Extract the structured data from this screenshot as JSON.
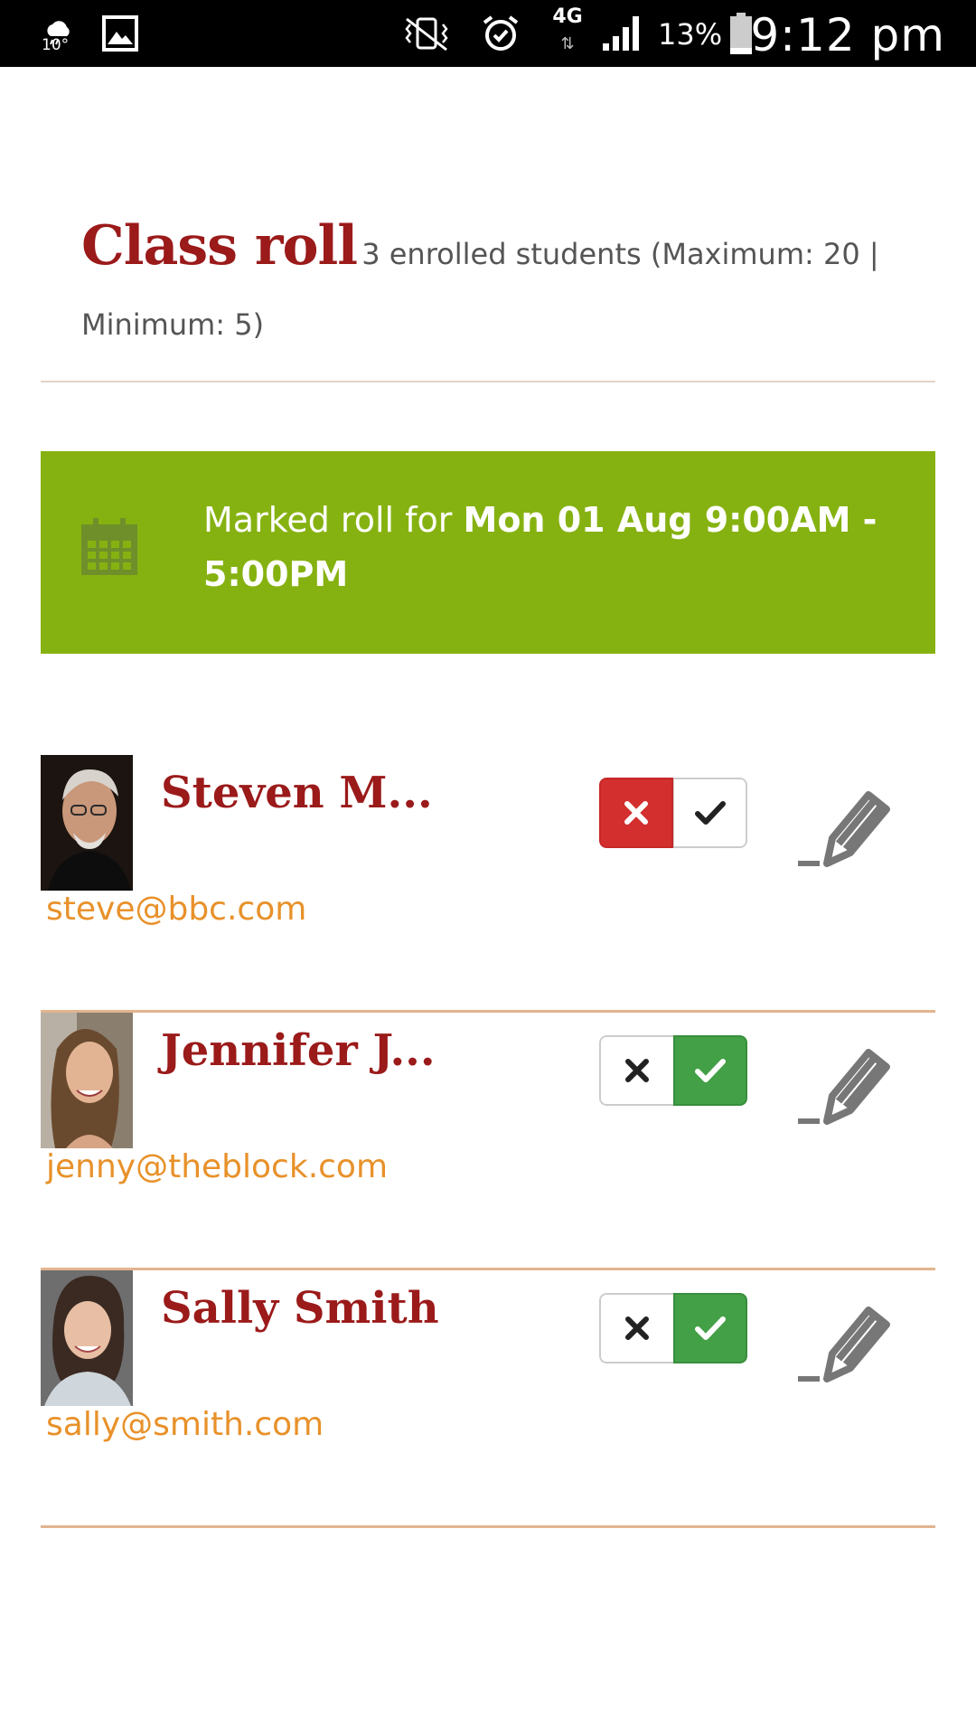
{
  "status_bar": {
    "weather_temp": "10°",
    "network_type": "4G",
    "network_arrows": "⇅",
    "battery_percent": "13%",
    "time": "9:12 pm",
    "icons": [
      "weather-icon",
      "gallery-icon",
      "vibrate-icon",
      "alarm-icon",
      "signal-icon",
      "battery-icon"
    ]
  },
  "header": {
    "title": "Class roll",
    "summary_line1": "3 enrolled students (Maximum: 20 |",
    "summary_line2": "Minimum: 5)"
  },
  "roll_banner": {
    "prefix": "Marked roll for ",
    "date_line1": "Mon 01 Aug 9:00AM -",
    "date_line2": "5:00PM",
    "icon": "calendar-icon",
    "color": "#86b211"
  },
  "students": [
    {
      "name": "Steven M...",
      "email": "steve@bbc.com",
      "status": "absent",
      "absent_symbol": "✖",
      "present_symbol": "✔"
    },
    {
      "name": "Jennifer J...",
      "email": "jenny@theblock.com",
      "status": "present",
      "absent_symbol": "✖",
      "present_symbol": "✔"
    },
    {
      "name": "Sally Smith",
      "email": "sally@smith.com",
      "status": "present",
      "absent_symbol": "✖",
      "present_symbol": "✔"
    }
  ],
  "colors": {
    "title": "#9b1a1a",
    "email": "#e8912a",
    "absent_active": "#d32f2f",
    "present_active": "#43a047",
    "divider": "#e2b48f"
  }
}
